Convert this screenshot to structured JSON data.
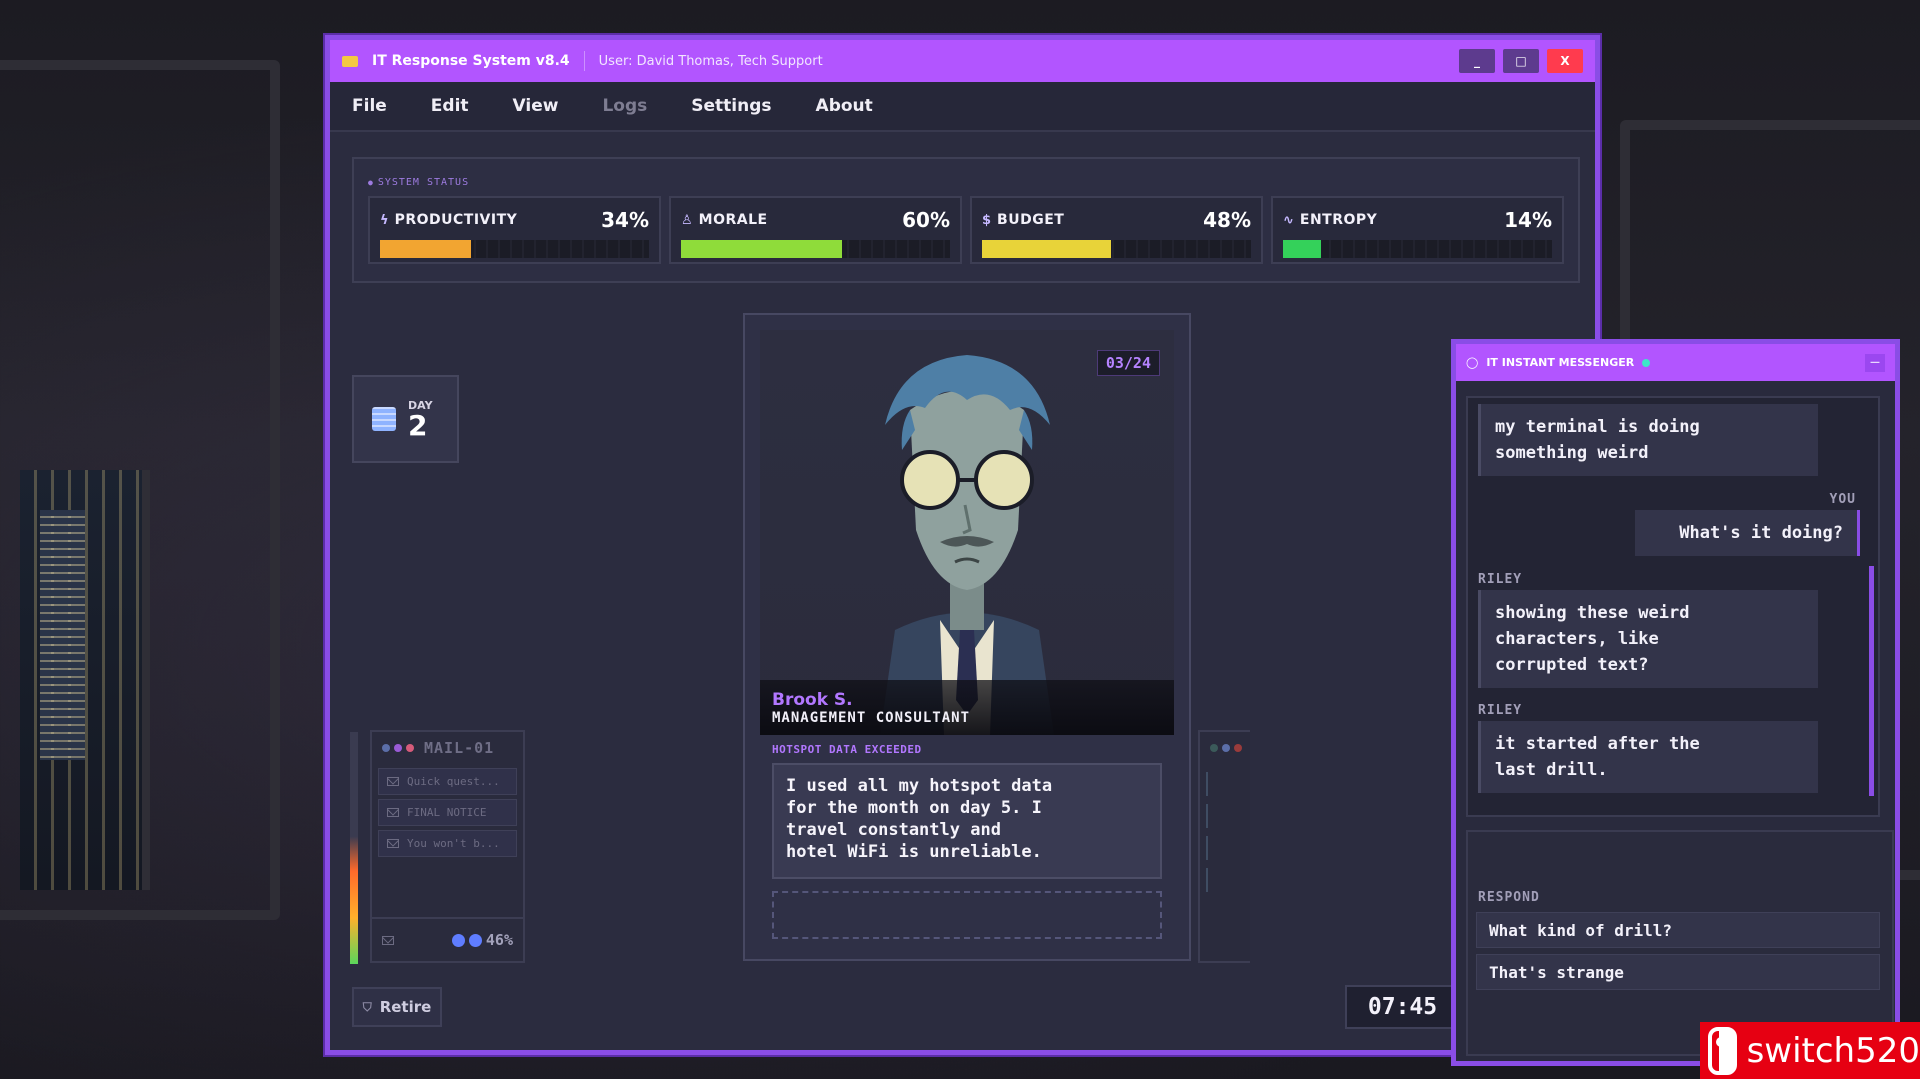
{
  "window": {
    "title": "IT Response System v8.4",
    "user": "User: David Thomas, Tech Support",
    "minimize": "_",
    "maximize": "□",
    "close": "X"
  },
  "menu": [
    "File",
    "Edit",
    "View",
    "Logs",
    "Settings",
    "About"
  ],
  "system_status": {
    "title": "SYSTEM STATUS",
    "stats": [
      {
        "label": "PRODUCTIVITY",
        "value": "34%",
        "fill": 0.34,
        "color": "#f2a531",
        "icon": "lightning-icon"
      },
      {
        "label": "MORALE",
        "value": "60%",
        "fill": 0.6,
        "color": "#8fdc3a",
        "icon": "person-icon"
      },
      {
        "label": "BUDGET",
        "value": "48%",
        "fill": 0.48,
        "color": "#e8d339",
        "icon": "dollar-icon"
      },
      {
        "label": "ENTROPY",
        "value": "14%",
        "fill": 0.14,
        "color": "#34d15a",
        "icon": "pulse-icon"
      }
    ]
  },
  "day": {
    "label": "DAY",
    "number": "2"
  },
  "ticket": {
    "counter": "03/24",
    "name": "Brook S.",
    "role": "MANAGEMENT CONSULTANT",
    "title": "HOTSPOT DATA EXCEEDED",
    "body": "I used all my hotspot data\nfor the month on day 5. I\ntravel constantly and\nhotel WiFi is unreliable."
  },
  "mail": {
    "title": "MAIL-01",
    "items": [
      "Quick quest...",
      "FINAL NOTICE",
      "You won't b..."
    ],
    "percent": "46%"
  },
  "bottom": {
    "retire": "Retire",
    "clock": "07:45"
  },
  "messenger": {
    "title": "IT INSTANT MESSENGER",
    "minimize": "—",
    "messages": [
      {
        "sender": "",
        "text": "my terminal is doing\nsomething weird"
      },
      {
        "sender": "YOU",
        "text": "What's it doing?"
      },
      {
        "sender": "RILEY",
        "text": "showing these weird\ncharacters, like\ncorrupted text?"
      },
      {
        "sender": "RILEY",
        "text": "it started after the\nlast drill."
      }
    ],
    "respond_label": "RESPOND",
    "replies": [
      "What kind of drill?",
      "That's strange"
    ]
  },
  "watermark": "switch520"
}
